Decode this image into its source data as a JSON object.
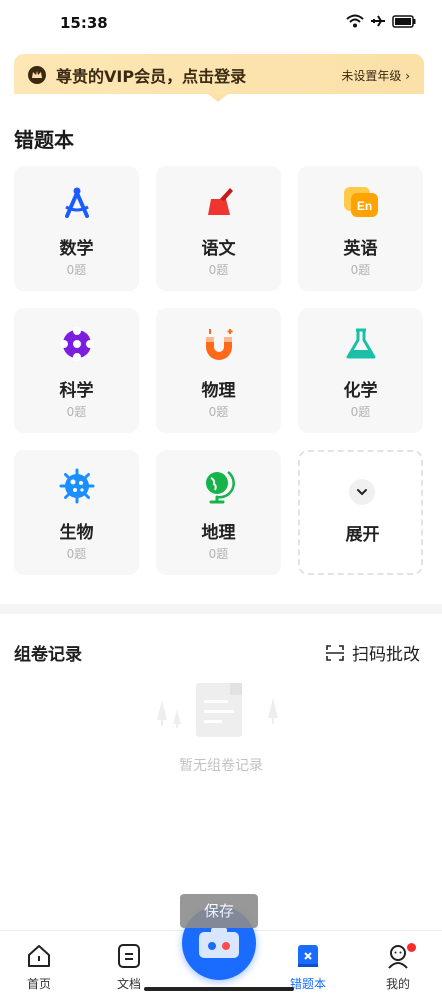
{
  "status_bar": {
    "time": "15:38"
  },
  "vip_banner": {
    "text": "尊贵的VIP会员，点击登录",
    "grade": "未设置年级 ›"
  },
  "section": {
    "title": "错题本"
  },
  "subjects": [
    {
      "name": "数学",
      "count": "0题",
      "icon": "compass-icon",
      "color": "#1a5cff"
    },
    {
      "name": "语文",
      "count": "0题",
      "icon": "brush-icon",
      "color": "#f0342f"
    },
    {
      "name": "英语",
      "count": "0题",
      "icon": "english-en-icon",
      "color": "#ffa300"
    },
    {
      "name": "科学",
      "count": "0题",
      "icon": "atom-flower-icon",
      "color": "#7a1fe0"
    },
    {
      "name": "物理",
      "count": "0题",
      "icon": "magnet-icon",
      "color": "#ff6a1a"
    },
    {
      "name": "化学",
      "count": "0题",
      "icon": "flask-icon",
      "color": "#1bbfa8"
    },
    {
      "name": "生物",
      "count": "0题",
      "icon": "cell-icon",
      "color": "#1a8fff"
    },
    {
      "name": "地理",
      "count": "0题",
      "icon": "globe-icon",
      "color": "#16b34a"
    }
  ],
  "expand": {
    "label": "展开"
  },
  "records": {
    "title": "组卷记录",
    "scan_label": "扫码批改",
    "empty_text": "暂无组卷记录"
  },
  "toast": {
    "text": "保存"
  },
  "tabbar": {
    "items": [
      {
        "label": "首页",
        "icon": "home-icon"
      },
      {
        "label": "文档",
        "icon": "document-icon"
      },
      {
        "label": "错题本",
        "icon": "mistake-book-icon",
        "active": true
      },
      {
        "label": "我的",
        "icon": "profile-icon"
      }
    ],
    "accent": "#1a6cff"
  }
}
